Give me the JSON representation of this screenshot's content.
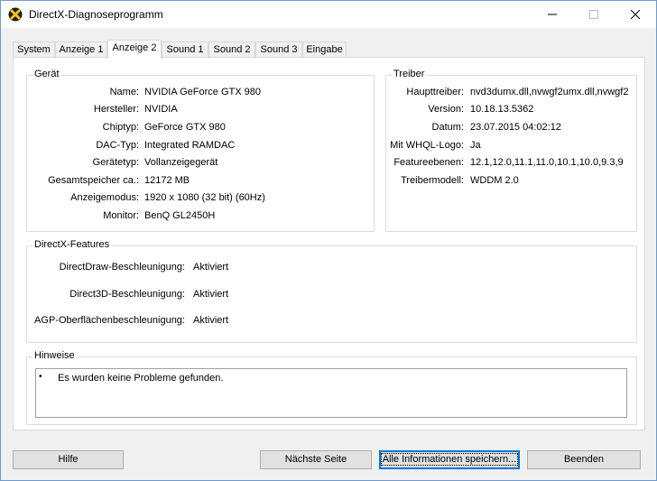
{
  "window": {
    "title": "DirectX-Diagnoseprogramm",
    "minimize": "—",
    "maximize": "☐",
    "close": "✕"
  },
  "tabs": [
    {
      "label": "System"
    },
    {
      "label": "Anzeige 1"
    },
    {
      "label": "Anzeige 2"
    },
    {
      "label": "Sound 1"
    },
    {
      "label": "Sound 2"
    },
    {
      "label": "Sound 3"
    },
    {
      "label": "Eingabe"
    }
  ],
  "active_tab": "Anzeige 2",
  "device": {
    "title": "Gerät",
    "rows": [
      {
        "label": "Name:",
        "value": "NVIDIA GeForce GTX 980"
      },
      {
        "label": "Hersteller:",
        "value": "NVIDIA"
      },
      {
        "label": "Chiptyp:",
        "value": "GeForce GTX 980"
      },
      {
        "label": "DAC-Typ:",
        "value": "Integrated RAMDAC"
      },
      {
        "label": "Gerätetyp:",
        "value": "Vollanzeigegerät"
      },
      {
        "label": "Gesamtspeicher ca.:",
        "value": "12172 MB"
      },
      {
        "label": "Anzeigemodus:",
        "value": "1920 x 1080 (32 bit) (60Hz)"
      },
      {
        "label": "Monitor:",
        "value": "BenQ GL2450H"
      }
    ]
  },
  "driver": {
    "title": "Treiber",
    "rows": [
      {
        "label": "Haupttreiber:",
        "value": "nvd3dumx.dll,nvwgf2umx.dll,nvwgf2"
      },
      {
        "label": "Version:",
        "value": "10.18.13.5362"
      },
      {
        "label": "Datum:",
        "value": "23.07.2015 04:02:12"
      },
      {
        "label": "Mit WHQL-Logo:",
        "value": "Ja"
      },
      {
        "label": "Featureebenen:",
        "value": "12.1,12.0,11.1,11.0,10.1,10.0,9.3,9"
      },
      {
        "label": "Treibermodell:",
        "value": "WDDM 2.0"
      }
    ]
  },
  "features": {
    "title": "DirectX-Features",
    "rows": [
      {
        "label": "DirectDraw-Beschleunigung:",
        "value": "Aktiviert"
      },
      {
        "label": "Direct3D-Beschleunigung:",
        "value": "Aktiviert"
      },
      {
        "label": "AGP-Oberflächenbeschleunigung:",
        "value": "Aktiviert"
      }
    ]
  },
  "notes": {
    "title": "Hinweise",
    "bullet": "•",
    "items": [
      "Es wurden keine Probleme gefunden."
    ]
  },
  "buttons": {
    "help": "Hilfe",
    "next_page": "Nächste Seite",
    "save_all": "Alle Informationen speichern...",
    "exit": "Beenden"
  }
}
